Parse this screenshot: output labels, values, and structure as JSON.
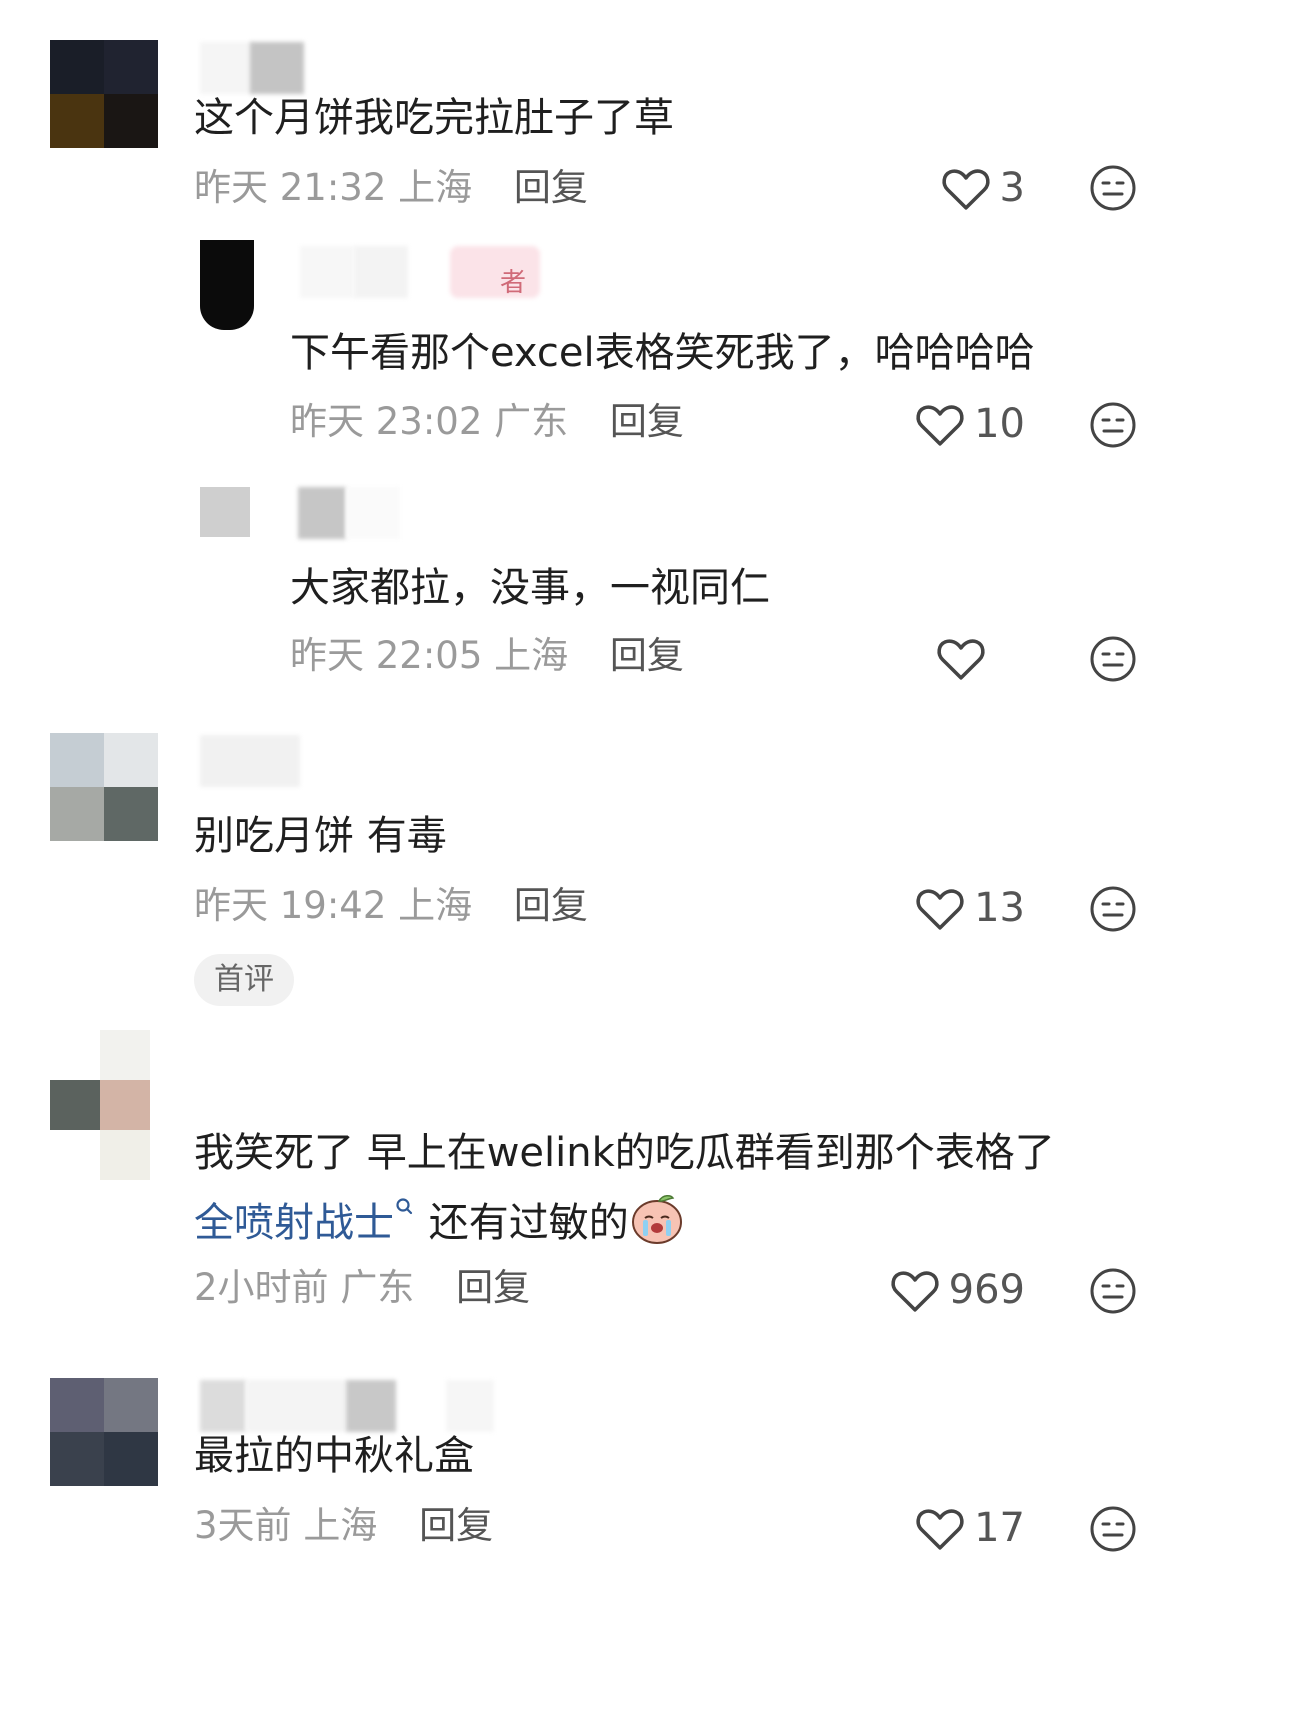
{
  "comments": [
    {
      "text": "这个月饼我吃完拉肚子了草",
      "time": "昨天 21:32",
      "location": "上海",
      "reply_label": "回复",
      "likes": "3",
      "avatar_colors": [
        "#1a1e28",
        "#202330",
        "#4a3410",
        "#1a1614"
      ],
      "replies": [
        {
          "name_tag": "者",
          "text": "下午看那个excel表格笑死我了，哈哈哈哈",
          "time": "昨天 23:02",
          "location": "广东",
          "reply_label": "回复",
          "likes": "10"
        },
        {
          "text": "大家都拉，没事，一视同仁",
          "time": "昨天 22:05",
          "location": "上海",
          "reply_label": "回复",
          "likes": ""
        }
      ]
    },
    {
      "text": "别吃月饼  有毒",
      "time": "昨天 19:42",
      "location": "上海",
      "reply_label": "回复",
      "likes": "13",
      "badge": "首评",
      "avatar_colors": [
        "#c5cdd3",
        "#e3e6e8",
        "#a6a9a5",
        "#5f6865"
      ]
    },
    {
      "text": "我笑死了  早上在welink的吃瓜群看到那个表格了",
      "line2_link": "全喷射战士",
      "line2_text": " 还有过敏的",
      "time": "2小时前",
      "location": "广东",
      "reply_label": "回复",
      "likes": "969",
      "avatar_colors": [
        "#f2f2ee",
        "#f0efe8",
        "#5b625e",
        "#d3b4a6"
      ]
    },
    {
      "text": "最拉的中秋礼盒",
      "time": "3天前",
      "location": "上海",
      "reply_label": "回复",
      "likes": "17",
      "avatar_colors": [
        "#5e5f72",
        "#747782",
        "#3a414d",
        "#2f3744"
      ]
    }
  ],
  "icons": {
    "like": "heart-outline-icon",
    "dislike": "neutral-face-icon",
    "search_hint": "search-mini-icon",
    "emoji": "crying-peach-emoji"
  },
  "colors": {
    "text": "#1f1f1f",
    "meta": "#9a9a9a",
    "link": "#2f5a96"
  }
}
